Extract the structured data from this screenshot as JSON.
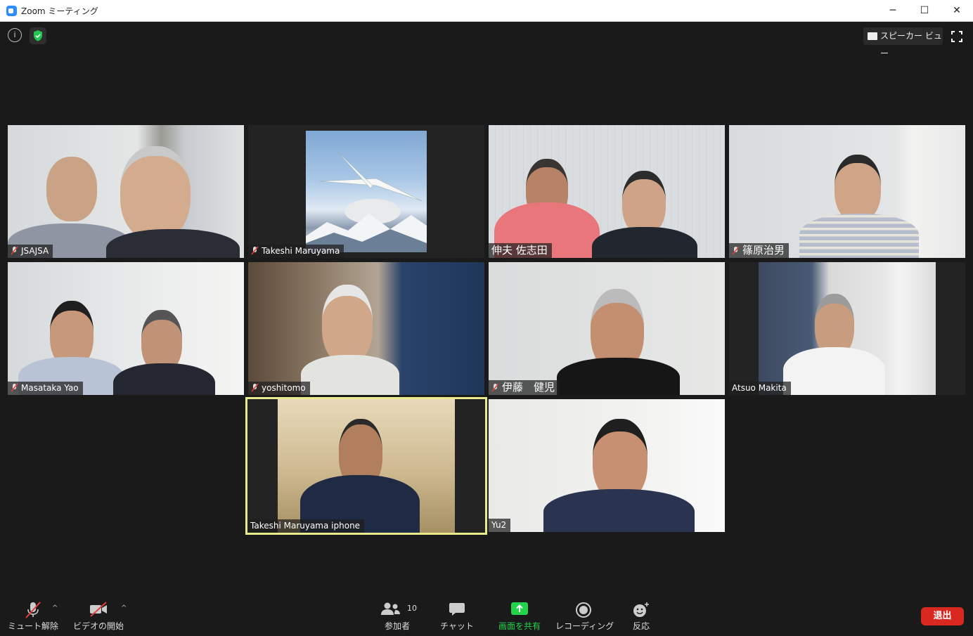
{
  "window": {
    "title": "Zoom ミーティング",
    "minimize": "─",
    "maximize": "☐",
    "close": "✕"
  },
  "top": {
    "info_glyph": "i",
    "speaker_view_label": "スピーカー ビュー"
  },
  "participants": [
    {
      "name": "JSAJSA",
      "muted": true
    },
    {
      "name": "Takeshi Maruyama",
      "muted": true
    },
    {
      "name": "伸夫 佐志田",
      "muted": false
    },
    {
      "name": "篠原治男",
      "muted": true
    },
    {
      "name": "Masataka Yao",
      "muted": true
    },
    {
      "name": "yoshitomo",
      "muted": true
    },
    {
      "name": "伊藤　健児",
      "muted": true
    },
    {
      "name": "Atsuo Makita",
      "muted": false
    },
    {
      "name": "Takeshi Maruyama iphone",
      "muted": false,
      "active_speaker": true
    },
    {
      "name": "Yu2",
      "muted": false
    }
  ],
  "toolbar": {
    "unmute_label": "ミュート解除",
    "start_video_label": "ビデオの開始",
    "participants_label": "参加者",
    "participants_count": "10",
    "chat_label": "チャット",
    "share_label": "画面を共有",
    "record_label": "レコーディング",
    "reactions_label": "反応",
    "leave_label": "退出",
    "caret": "^"
  },
  "colors": {
    "accent_green": "#22d34b",
    "leave_red": "#d9281f",
    "active_border": "#e9e98e",
    "mute_red": "#e0413a"
  }
}
